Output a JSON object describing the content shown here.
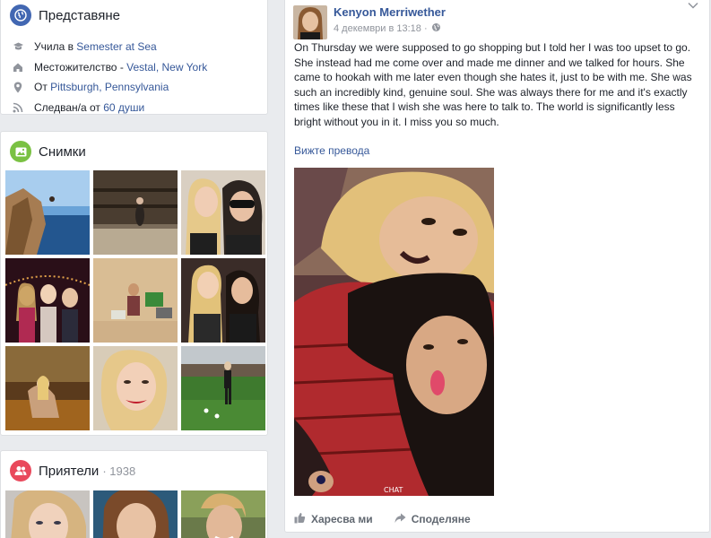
{
  "intro": {
    "title": "Представяне",
    "items": [
      {
        "icon": "education-icon",
        "prefix": "Учила в ",
        "link": "Semester at Sea",
        "suffix": ""
      },
      {
        "icon": "home-icon",
        "prefix": "Местожителство - ",
        "link": "Vestal, New York",
        "suffix": ""
      },
      {
        "icon": "location-pin-icon",
        "prefix": "От ",
        "link": "Pittsburgh, Pennsylvania",
        "suffix": ""
      },
      {
        "icon": "rss-icon",
        "prefix": "Следван/а от ",
        "link": "60 души",
        "suffix": ""
      }
    ]
  },
  "photos": {
    "title": "Снимки"
  },
  "friends": {
    "title": "Приятели",
    "count": "· 1938"
  },
  "post": {
    "author": "Kenyon Merriwether",
    "timestamp": "4 декември в 13:18 · ",
    "text": "On Thursday we were supposed to go shopping but I told her I was too upset to go. She instead had me come over and made me dinner and we talked for hours. She came to hookah with me later even though she hates it, just to be with me. She was such an incredibly kind, genuine soul. She was always there for me and it's exactly times like these that I wish she was here to talk to. The world is significantly less bright without you in it. I miss you so much.",
    "see_translation": "Вижте превода",
    "photo_watermark": "CHAT",
    "like_label": "Харесва ми",
    "share_label": "Споделяне"
  },
  "colors": {
    "link": "#365899",
    "intro_icon": "#4267b2",
    "photos_icon": "#7ac143",
    "friends_icon": "#e9495c"
  }
}
